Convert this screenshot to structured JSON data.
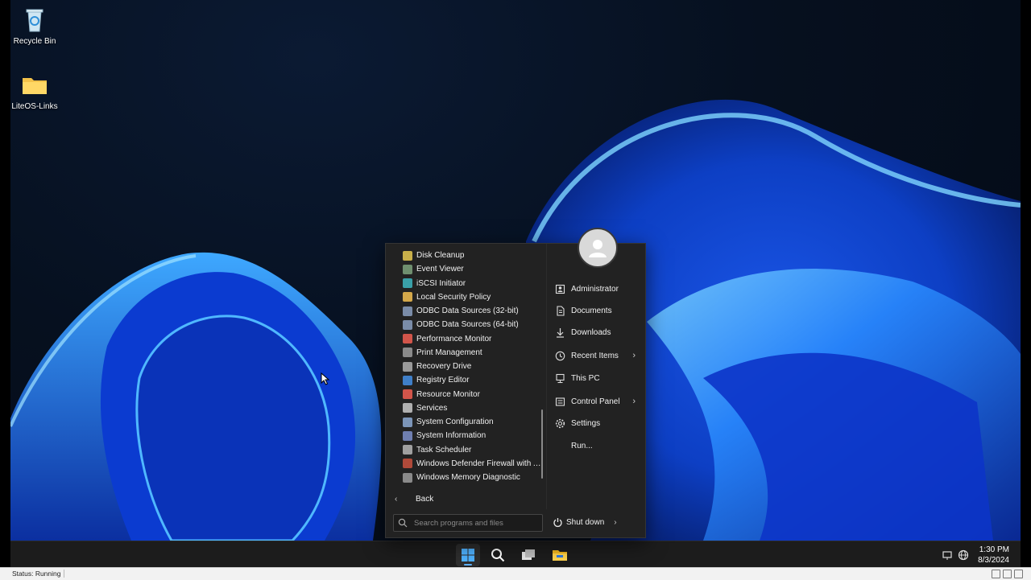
{
  "desktop": {
    "icons": [
      {
        "label": "Recycle Bin",
        "icon": "recycle-bin-icon"
      },
      {
        "label": "LiteOS-Links",
        "icon": "folder-icon"
      }
    ]
  },
  "start_menu": {
    "programs": [
      {
        "label": "Disk Cleanup",
        "color": "#c9b04a"
      },
      {
        "label": "Event Viewer",
        "color": "#6f8f6f"
      },
      {
        "label": "iSCSI Initiator",
        "color": "#3aa0a8"
      },
      {
        "label": "Local Security Policy",
        "color": "#d4a84a"
      },
      {
        "label": "ODBC Data Sources (32-bit)",
        "color": "#7a8ca8"
      },
      {
        "label": "ODBC Data Sources (64-bit)",
        "color": "#7a8ca8"
      },
      {
        "label": "Performance Monitor",
        "color": "#d2554a"
      },
      {
        "label": "Print Management",
        "color": "#8a8a8a"
      },
      {
        "label": "Recovery Drive",
        "color": "#9a9a9a"
      },
      {
        "label": "Registry Editor",
        "color": "#3f7fc8"
      },
      {
        "label": "Resource Monitor",
        "color": "#d2554a"
      },
      {
        "label": "Services",
        "color": "#b0b0b0"
      },
      {
        "label": "System Configuration",
        "color": "#7c95b8"
      },
      {
        "label": "System Information",
        "color": "#6f7fb0"
      },
      {
        "label": "Task Scheduler",
        "color": "#a0a0a0"
      },
      {
        "label": "Windows Defender Firewall with A...",
        "color": "#b04a3a"
      },
      {
        "label": "Windows Memory Diagnostic",
        "color": "#8a8a8a"
      }
    ],
    "back_label": "Back",
    "search_placeholder": "Search programs and files",
    "places": [
      {
        "label": "Administrator",
        "icon": "user-folder-icon",
        "has_submenu": false
      },
      {
        "label": "Documents",
        "icon": "document-icon",
        "has_submenu": false
      },
      {
        "label": "Downloads",
        "icon": "download-icon",
        "has_submenu": false
      },
      {
        "label": "Recent Items",
        "icon": "clock-icon",
        "has_submenu": true
      },
      {
        "label": "This PC",
        "icon": "computer-icon",
        "has_submenu": false
      },
      {
        "label": "Control Panel",
        "icon": "control-panel-icon",
        "has_submenu": true
      },
      {
        "label": "Settings",
        "icon": "gear-icon",
        "has_submenu": false
      },
      {
        "label": "Run...",
        "icon": "run-icon",
        "has_submenu": false
      }
    ],
    "shutdown_label": "Shut down"
  },
  "taskbar": {
    "buttons": [
      {
        "icon": "windows-start-icon",
        "active": true
      },
      {
        "icon": "search-icon",
        "active": false
      },
      {
        "icon": "task-view-icon",
        "active": false
      },
      {
        "icon": "file-explorer-icon",
        "active": false
      }
    ],
    "tray": {
      "icons": [
        "network-icon",
        "globe-icon"
      ],
      "time": "1:30 PM",
      "date": "8/3/2024"
    }
  },
  "vm_status": {
    "text": "Status: Running"
  },
  "colors": {
    "accent": "#5fb2ff",
    "menu_bg": "#222222",
    "taskbar_bg": "#1c1c1c"
  }
}
